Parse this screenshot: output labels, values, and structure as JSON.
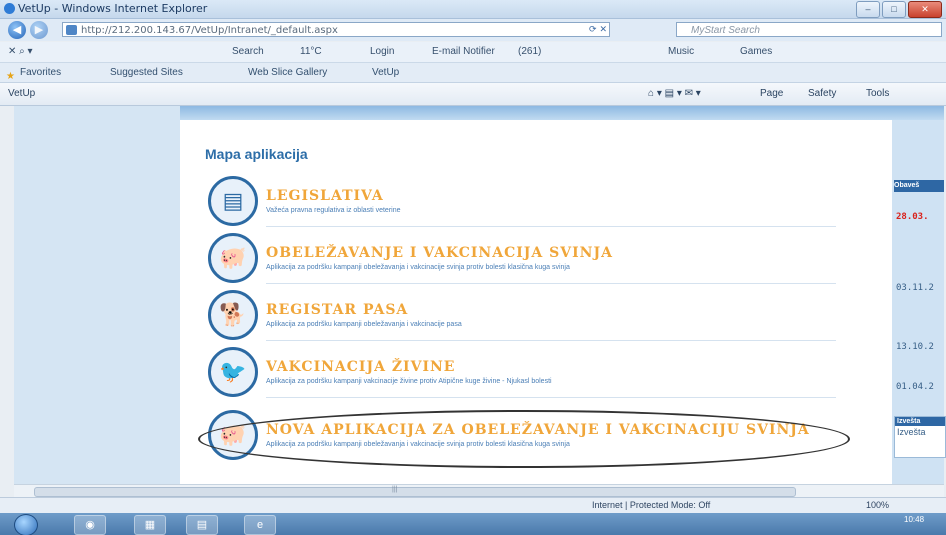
{
  "window": {
    "title": "VetUp - Windows Internet Explorer",
    "buttons": [
      "–",
      "□",
      "✕"
    ]
  },
  "address_bar": {
    "url": "http://212.200.143.67/VetUp/Intranet/_default.aspx",
    "search_placeholder": "MyStart Search"
  },
  "toolbar": {
    "search": "Search",
    "weather": "11°C",
    "login": "Login",
    "email_notifier": "E-mail Notifier",
    "count": "(261)",
    "music": "Music",
    "games": "Games"
  },
  "favorites_bar": {
    "favorites": "Favorites",
    "suggested_sites": "Suggested Sites",
    "web_slice_gallery": "Web Slice Gallery",
    "vetup": "VetUp"
  },
  "command_bar": {
    "tab_title": "VetUp",
    "page": "Page",
    "safety": "Safety",
    "tools": "Tools"
  },
  "page": {
    "map_title": "Mapa aplikacija",
    "apps": [
      {
        "title": "LEGISLATIVA",
        "description": "Važeća pravna regulativa iz oblasti veterine",
        "icon": "document-icon"
      },
      {
        "title": "OBELEŽAVANJE I VAKCINACIJA SVINJA",
        "description": "Aplikacija za podršku kampanji obeležavanja i vakcinacije svinja protiv bolesti klasična kuga svinja",
        "icon": "pig-icon"
      },
      {
        "title": "REGISTAR PASA",
        "description": "Aplikacija za podršku kampanji obeležavanja i vakcinacije pasa",
        "icon": "dog-icon"
      },
      {
        "title": "VAKCINACIJA ŽIVINE",
        "description": "Aplikacija za podršku kampanji vakcinacije živine protiv Atipične kuge živine - Njukasl bolesti",
        "icon": "bird-icon"
      },
      {
        "title": "NOVA APLIKACIJA ZA OBELEŽAVANJE I VAKCINACIJU SVINJA",
        "description": "Aplikacija za podršku kampanji obeležavanja i vakcinacije svinja protiv bolesti klasična kuga svinja",
        "icon": "pig-icon"
      }
    ],
    "right_panel": {
      "header": "Obaveš",
      "dates": [
        "28.03.",
        "03.11.2",
        "13.10.2",
        "01.04.2"
      ],
      "box2_header": "Izvešta",
      "box2_text": "Izvešta"
    }
  },
  "status_bar": {
    "zone": "Internet | Protected Mode: Off",
    "zoom": "100%"
  },
  "taskbar": {
    "clock_time": "10:48"
  },
  "colors": {
    "title_accent": "#f0a63a",
    "link_blue": "#2d6ea8",
    "alert_red": "#d9231c"
  }
}
